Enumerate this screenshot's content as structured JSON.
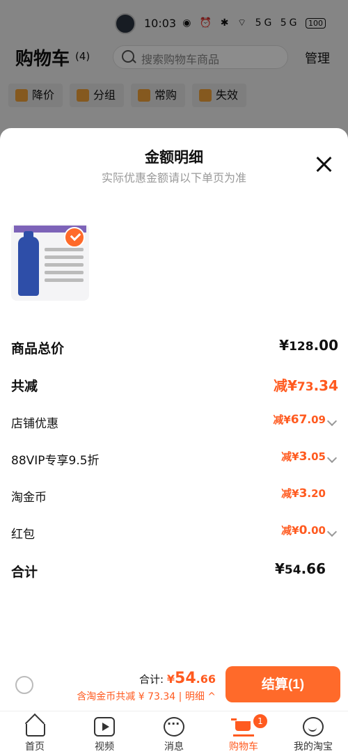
{
  "status_bar": {
    "time": "10:03",
    "icons": "◉ ⏰ ✱ ⌔ 5G 5G",
    "battery": "100"
  },
  "header": {
    "title": "购物车",
    "count": "(4)",
    "search_placeholder": "搜索购物车商品",
    "manage": "管理"
  },
  "filters": [
    {
      "label": "降价"
    },
    {
      "label": "分组"
    },
    {
      "label": "常购"
    },
    {
      "label": "失效"
    }
  ],
  "sheet": {
    "title": "金额明细",
    "subtitle": "实际优惠金额请以下单页为准",
    "rows": [
      {
        "label": "商品总价",
        "prefix": "¥",
        "int": "128",
        "dec": ".00"
      },
      {
        "label": "共减",
        "prefix": "减¥",
        "int": "73",
        "dec": ".34"
      },
      {
        "label": "店铺优惠",
        "prefix": "减¥",
        "int": "67",
        "dec": ".09"
      },
      {
        "label": "88VIP专享9.5折",
        "prefix": "减¥",
        "int": "3",
        "dec": ".05"
      },
      {
        "label": "淘金币",
        "prefix": "减¥",
        "int": "3",
        "dec": ".20"
      },
      {
        "label": "红包",
        "prefix": "减¥",
        "int": "0",
        "dec": ".00"
      },
      {
        "label": "合计",
        "prefix": "¥",
        "int": "54",
        "dec": ".66"
      }
    ]
  },
  "footer": {
    "total_label": "合计:",
    "total_prefix": "¥",
    "total_int": "54",
    "total_dec": ".66",
    "savings": "含淘金币共减 ¥ 73.34 | 明细 ^",
    "pay_button": "结算(1)"
  },
  "tabbar": [
    {
      "label": "首页"
    },
    {
      "label": "视频"
    },
    {
      "label": "消息"
    },
    {
      "label": "购物车",
      "badge": "1"
    },
    {
      "label": "我的淘宝"
    }
  ],
  "colors": {
    "accent": "#ff5a1f",
    "button": "#ff6a2a"
  }
}
